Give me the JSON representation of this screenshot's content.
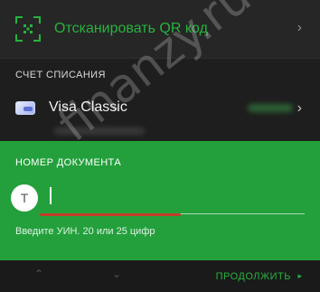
{
  "qr": {
    "label": "Отсканировать QR код",
    "icon": "qr-scan-icon",
    "chevron": "›"
  },
  "account": {
    "header": "СЧЕТ СПИСАНИЯ",
    "card_name": "Visa Classic",
    "card_icon": "credit-card-icon",
    "chevron": "›"
  },
  "document": {
    "header": "НОМЕР ДОКУМЕНТА",
    "avatar_letter": "Т",
    "input_value": "",
    "hint": "Введите УИН. 20 или 25 цифр"
  },
  "bottom": {
    "up_arrow": "⌃",
    "down_arrow": "⌄",
    "continue_label": "ПРОДОЛЖИТЬ",
    "continue_arrow": "▸"
  },
  "watermark": "finanzy.ru",
  "colors": {
    "accent": "#27b33f",
    "panel_green": "#23a03c",
    "background": "#1c1c1c",
    "annotation_red": "#c43d2a"
  }
}
